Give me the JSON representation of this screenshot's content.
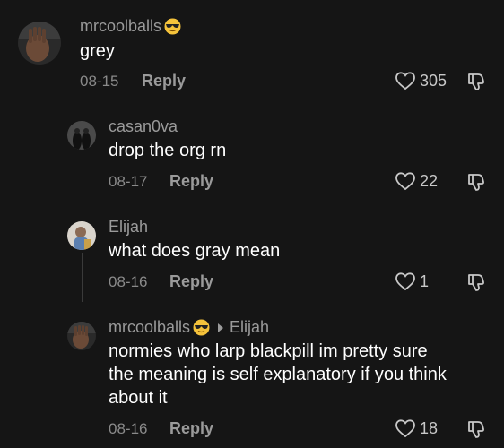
{
  "comments": [
    {
      "username": "mrcoolballs",
      "has_emoji": true,
      "emoji": "😎",
      "text": "grey",
      "date": "08-15",
      "reply_label": "Reply",
      "likes": "305",
      "icons": [
        "heart-outline-icon",
        "thumbs-down-icon"
      ]
    },
    {
      "username": "casan0va",
      "text": "drop the org rn",
      "date": "08-17",
      "reply_label": "Reply",
      "likes": "22"
    },
    {
      "username": "Elijah",
      "text": "what does gray mean",
      "date": "08-16",
      "reply_label": "Reply",
      "likes": "1"
    },
    {
      "username": "mrcoolballs",
      "emoji": "😎",
      "reply_to": "Elijah",
      "text_lines": [
        "normies who larp blackpill im pretty sure",
        "the meaning is self explanatory if you think",
        "about it"
      ],
      "date": "08-16",
      "reply_label": "Reply",
      "likes": "18"
    }
  ],
  "colors": {
    "background": "#151515",
    "username": "#9a9a9a",
    "text": "#ffffff",
    "meta": "#8a8a8a"
  }
}
